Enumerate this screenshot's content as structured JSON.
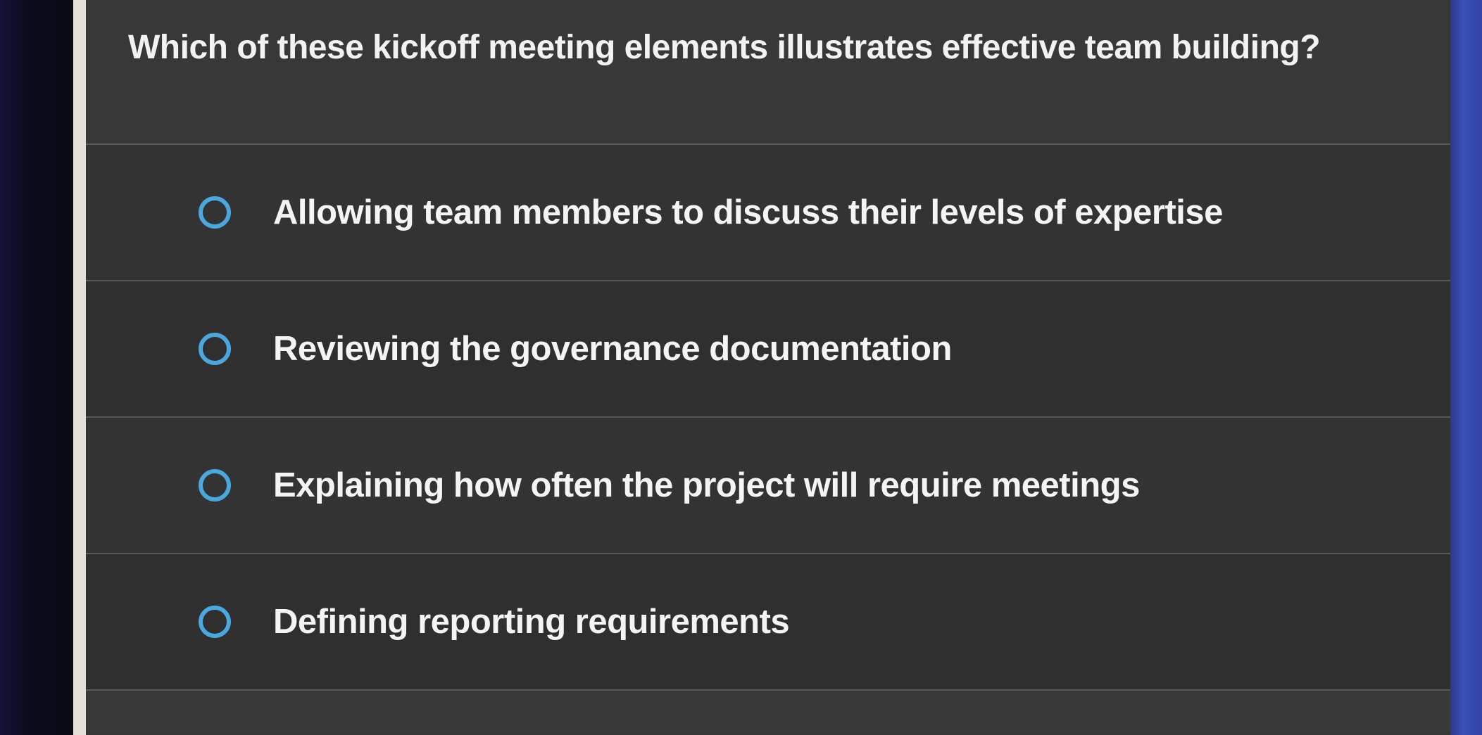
{
  "question": {
    "text": "Which of these kickoff meeting elements illustrates effective team building?"
  },
  "options": [
    {
      "label": "Allowing team members to discuss their levels of expertise",
      "selected": false
    },
    {
      "label": "Reviewing the governance documentation",
      "selected": false
    },
    {
      "label": "Explaining how often the project will require meetings",
      "selected": false
    },
    {
      "label": "Defining reporting requirements",
      "selected": false
    }
  ],
  "colors": {
    "radio_accent": "#4aa8df",
    "panel_background": "#363636",
    "text": "#f2f2f2"
  },
  "icons": {
    "radio": "radio-unchecked-icon"
  }
}
